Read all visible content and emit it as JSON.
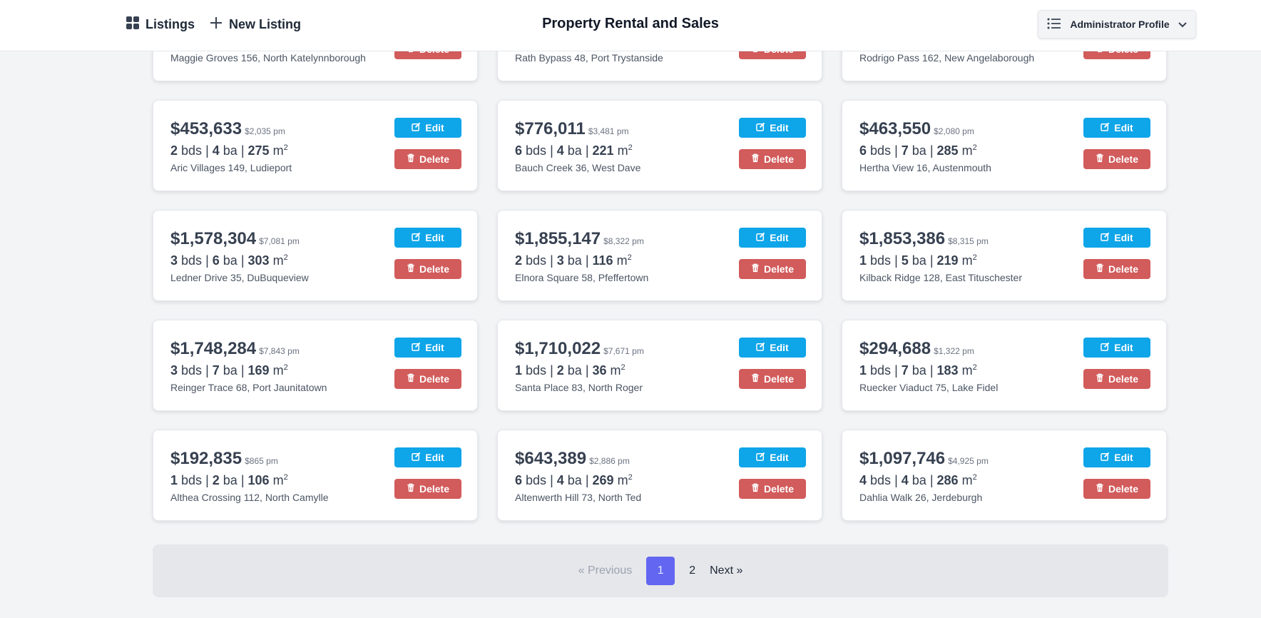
{
  "header": {
    "nav": [
      {
        "icon": "grid-icon",
        "label": "Listings"
      },
      {
        "icon": "plus-icon",
        "label": "New Listing"
      }
    ],
    "title": "Property Rental and Sales",
    "profile_label": "Administrator Profile"
  },
  "listings": [
    {
      "price": "",
      "pm": "",
      "bds": "",
      "ba": "",
      "area": "",
      "address": "Maggie Groves 156, North Katelynnborough"
    },
    {
      "price": "",
      "pm": "",
      "bds": "",
      "ba": "",
      "area": "",
      "address": "Rath Bypass 48, Port Trystanside"
    },
    {
      "price": "",
      "pm": "",
      "bds": "",
      "ba": "",
      "area": "",
      "address": "Rodrigo Pass 162, New Angelaborough"
    },
    {
      "price": "$453,633",
      "pm": "$2,035 pm",
      "bds": "2",
      "ba": "4",
      "area": "275",
      "address": "Aric Villages 149, Ludieport"
    },
    {
      "price": "$776,011",
      "pm": "$3,481 pm",
      "bds": "6",
      "ba": "4",
      "area": "221",
      "address": "Bauch Creek 36, West Dave"
    },
    {
      "price": "$463,550",
      "pm": "$2,080 pm",
      "bds": "6",
      "ba": "7",
      "area": "285",
      "address": "Hertha View 16, Austenmouth"
    },
    {
      "price": "$1,578,304",
      "pm": "$7,081 pm",
      "bds": "3",
      "ba": "6",
      "area": "303",
      "address": "Ledner Drive 35, DuBuqueview"
    },
    {
      "price": "$1,855,147",
      "pm": "$8,322 pm",
      "bds": "2",
      "ba": "3",
      "area": "116",
      "address": "Elnora Square 58, Pfeffertown"
    },
    {
      "price": "$1,853,386",
      "pm": "$8,315 pm",
      "bds": "1",
      "ba": "5",
      "area": "219",
      "address": "Kilback Ridge 128, East Tituschester"
    },
    {
      "price": "$1,748,284",
      "pm": "$7,843 pm",
      "bds": "3",
      "ba": "7",
      "area": "169",
      "address": "Reinger Trace 68, Port Jaunitatown"
    },
    {
      "price": "$1,710,022",
      "pm": "$7,671 pm",
      "bds": "1",
      "ba": "2",
      "area": "36",
      "address": "Santa Place 83, North Roger"
    },
    {
      "price": "$294,688",
      "pm": "$1,322 pm",
      "bds": "1",
      "ba": "7",
      "area": "183",
      "address": "Ruecker Viaduct 75, Lake Fidel"
    },
    {
      "price": "$192,835",
      "pm": "$865 pm",
      "bds": "1",
      "ba": "2",
      "area": "106",
      "address": "Althea Crossing 112, North Camylle"
    },
    {
      "price": "$643,389",
      "pm": "$2,886 pm",
      "bds": "6",
      "ba": "4",
      "area": "269",
      "address": "Altenwerth Hill 73, North Ted"
    },
    {
      "price": "$1,097,746",
      "pm": "$4,925 pm",
      "bds": "4",
      "ba": "4",
      "area": "286",
      "address": "Dahlia Walk 26, Jerdeburgh"
    }
  ],
  "labels": {
    "bds": "bds",
    "ba": "ba",
    "unit": "m",
    "sup": "2",
    "edit": "Edit",
    "delete": "Delete"
  },
  "pagination": {
    "prev": "« Previous",
    "pages": [
      "1",
      "2"
    ],
    "current": "1",
    "next": "Next »"
  },
  "colors": {
    "edit": "#0ea5e9",
    "delete": "#d25b5b",
    "active_page": "#6366f1"
  }
}
